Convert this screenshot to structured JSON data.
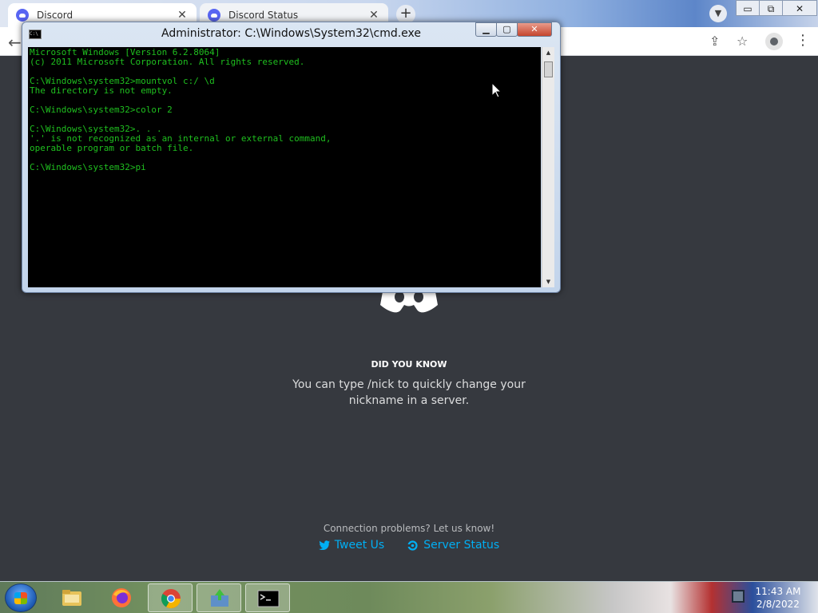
{
  "browser": {
    "tabs": [
      {
        "label": "Discord",
        "active": true
      },
      {
        "label": "Discord Status",
        "active": false
      }
    ],
    "new_tab_label": "+",
    "window_buttons": {
      "minimize": "▭",
      "restore": "⧉",
      "close": "✕"
    }
  },
  "discord": {
    "did_you_know": "DID YOU KNOW",
    "tip": "You can type /nick to quickly change your nickname in a server.",
    "connection": "Connection problems? Let us know!",
    "tweet_label": "Tweet Us",
    "status_label": "Server Status",
    "link_color": "#00aff4",
    "background": "#36393f"
  },
  "cmd": {
    "title": "Administrator: C:\\Windows\\System32\\cmd.exe",
    "icon_text": "C:\\",
    "lines": [
      "Microsoft Windows [Version 6.2.8064]",
      "(c) 2011 Microsoft Corporation. All rights reserved.",
      "",
      "C:\\Windows\\system32>mountvol c:/ \\d",
      "The directory is not empty.",
      "",
      "C:\\Windows\\system32>color 2",
      "",
      "C:\\Windows\\system32>. . .",
      "'.' is not recognized as an internal or external command,",
      "operable program or batch file.",
      "",
      "C:\\Windows\\system32>pi"
    ],
    "text_color": "#1fbf1f"
  },
  "taskbar": {
    "time": "11:43 AM",
    "date": "2/8/2022"
  }
}
